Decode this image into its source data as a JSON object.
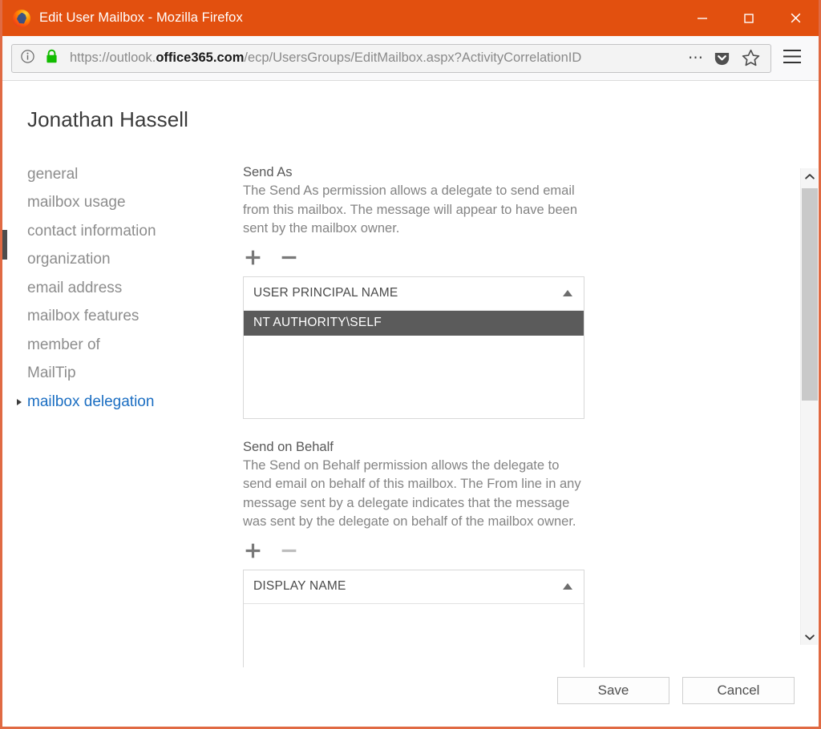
{
  "window": {
    "title": "Edit User Mailbox - Mozilla Firefox",
    "logo_icon": "firefox-logo",
    "controls": {
      "minimize_label": "Minimize",
      "maximize_label": "Maximize",
      "close_label": "Close"
    },
    "titlebar_color": "#e2500f",
    "border_color": "#e06a43"
  },
  "toolbar": {
    "info_icon": "info-circle-icon",
    "lock_icon": "padlock-secure-icon",
    "url_prefix": "https://outlook.",
    "url_domain": "office365.com",
    "url_path": "/ecp/UsersGroups/EditMailbox.aspx?ActivityCorrelationID",
    "url_full": "https://outlook.office365.com/ecp/UsersGroups/EditMailbox.aspx?ActivityCorrelationID",
    "page_actions_icon": "ellipsis-icon",
    "pocket_icon": "pocket-icon",
    "bookmark_icon": "star-bookmark-icon",
    "menu_icon": "hamburger-menu-icon"
  },
  "page": {
    "title": "Jonathan Hassell"
  },
  "sidebar": {
    "items": [
      {
        "label": "general",
        "selected": false
      },
      {
        "label": "mailbox usage",
        "selected": false
      },
      {
        "label": "contact information",
        "selected": false
      },
      {
        "label": "organization",
        "selected": false
      },
      {
        "label": "email address",
        "selected": false
      },
      {
        "label": "mailbox features",
        "selected": false
      },
      {
        "label": "member of",
        "selected": false
      },
      {
        "label": "MailTip",
        "selected": false
      },
      {
        "label": "mailbox delegation",
        "selected": true
      }
    ],
    "selected_color": "#1b6ec2"
  },
  "sections": {
    "send_as": {
      "title": "Send As",
      "description": "The Send As permission allows a delegate to send email from this mailbox. The message will appear to have been sent by the mailbox owner.",
      "add_icon": "plus-icon",
      "remove_icon": "minus-icon",
      "list": {
        "column_header": "USER PRINCIPAL NAME",
        "sort_icon": "sort-ascending-caret-icon",
        "rows": [
          {
            "value": "NT AUTHORITY\\SELF",
            "selected": true
          }
        ],
        "selected_row_color": "#5b5b5b"
      }
    },
    "send_on_behalf": {
      "title": "Send on Behalf",
      "description": "The Send on Behalf permission allows the delegate to send email on behalf of this mailbox. The From line in any message sent by a delegate indicates that the message was sent by the delegate on behalf of the mailbox owner.",
      "add_icon": "plus-icon",
      "remove_icon": "minus-icon",
      "list": {
        "column_header": "DISPLAY NAME",
        "sort_icon": "sort-ascending-caret-icon",
        "rows": []
      }
    }
  },
  "scrollbar": {
    "up_icon": "chevron-up-icon",
    "down_icon": "chevron-down-icon"
  },
  "footer": {
    "save_label": "Save",
    "cancel_label": "Cancel"
  }
}
